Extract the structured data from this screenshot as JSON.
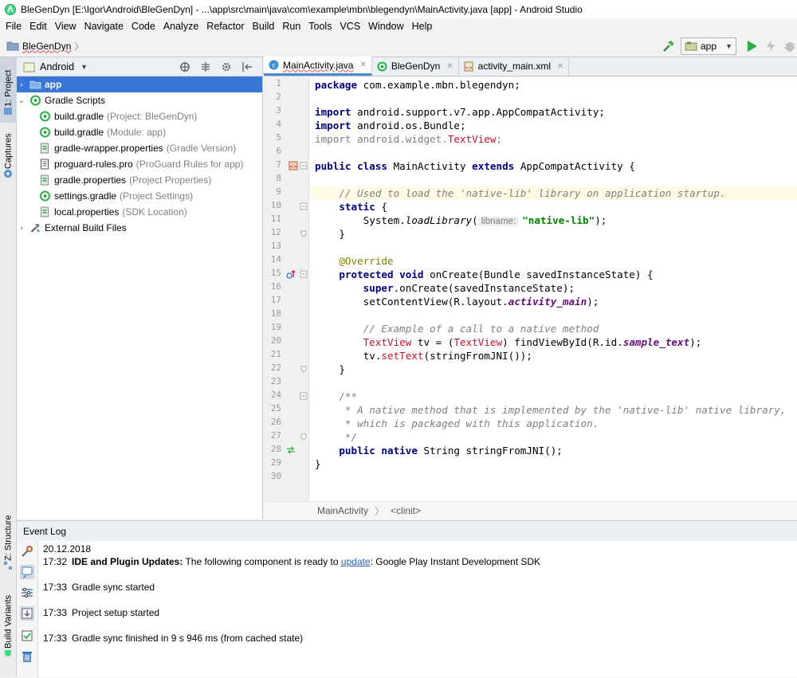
{
  "window": {
    "title": "BleGenDyn [E:\\Igor\\Android\\BleGenDyn] - ...\\app\\src\\main\\java\\com\\example\\mbn\\blegendyn\\MainActivity.java [app] - Android Studio"
  },
  "menu": [
    "File",
    "Edit",
    "View",
    "Navigate",
    "Code",
    "Analyze",
    "Refactor",
    "Build",
    "Run",
    "Tools",
    "VCS",
    "Window",
    "Help"
  ],
  "navbar": {
    "project_crumb": "BleGenDyn",
    "run_config": "app"
  },
  "left_tool_tabs": {
    "project": "1: Project",
    "captures": "Captures",
    "structure": "Z: Structure",
    "build_variants": "Build Variants"
  },
  "project_panel": {
    "view_mode": "Android",
    "tree": [
      {
        "label": "app",
        "hint": "",
        "expander": "›"
      },
      {
        "label": "Gradle Scripts",
        "hint": "",
        "expander": "⌄"
      },
      {
        "label": "build.gradle",
        "hint": "(Project: BleGenDyn)",
        "expander": ""
      },
      {
        "label": "build.gradle",
        "hint": "(Module: app)",
        "expander": ""
      },
      {
        "label": "gradle-wrapper.properties",
        "hint": "(Gradle Version)",
        "expander": ""
      },
      {
        "label": "proguard-rules.pro",
        "hint": "(ProGuard Rules for app)",
        "expander": ""
      },
      {
        "label": "gradle.properties",
        "hint": "(Project Properties)",
        "expander": ""
      },
      {
        "label": "settings.gradle",
        "hint": "(Project Settings)",
        "expander": ""
      },
      {
        "label": "local.properties",
        "hint": "(SDK Location)",
        "expander": ""
      },
      {
        "label": "External Build Files",
        "hint": "",
        "expander": "›"
      }
    ]
  },
  "editor_tabs": [
    {
      "label": "MainActivity.java"
    },
    {
      "label": "BleGenDyn"
    },
    {
      "label": "activity_main.xml"
    }
  ],
  "line_numbers": [
    "1",
    "2",
    "3",
    "4",
    "5",
    "6",
    "7",
    "8",
    "9",
    "10",
    "11",
    "12",
    "13",
    "14",
    "15",
    "16",
    "17",
    "18",
    "19",
    "20",
    "21",
    "22",
    "23",
    "24",
    "25",
    "26",
    "27",
    "28",
    "29",
    "30"
  ],
  "code": {
    "l1_kw": "package",
    "l1_rest": " com.example.mbn.blegendyn;",
    "l3_kw": "import",
    "l3_rest": " android.support.v7.app.AppCompatActivity;",
    "l4_kw": "import",
    "l4_rest": " android.os.Bundle;",
    "l5_a": "import android.widget.",
    "l5_b": "TextView",
    "l5_c": ";",
    "l7_kw1": "public class",
    "l7_a": " MainActivity ",
    "l7_kw2": "extends",
    "l7_b": " AppCompatActivity {",
    "l9_cmt": "    // Used to load the 'native-lib' library on application startup.",
    "l10_kw": "    static",
    "l10_rest": " {",
    "l11_a": "        System.",
    "l11_b": "loadLibrary",
    "l11_c": "(",
    "l11_hint": "libname:",
    "l11_str": "\"native-lib\"",
    "l11_d": ");",
    "l12": "    }",
    "l14_ann": "    @Override",
    "l15_kw": "    protected void",
    "l15_rest": " onCreate(Bundle savedInstanceState) {",
    "l16_kw": "        super",
    "l16_rest": ".onCreate(savedInstanceState);",
    "l17_a": "        setContentView(R.layout.",
    "l17_fld": "activity_main",
    "l17_b": ");",
    "l19_cmt": "        // Example of a call to a native method",
    "l20_a": "        ",
    "l20_red1": "TextView",
    "l20_b": " tv = (",
    "l20_red2": "TextView",
    "l20_c": ") findViewById(R.id.",
    "l20_fld": "sample_text",
    "l20_d": ");",
    "l21_a": "        tv.",
    "l21_red": "setText",
    "l21_b": "(stringFromJNI());",
    "l22": "    }",
    "l24_cmt": "    /**",
    "l25_cmt": "     * A native method that is implemented by the 'native-lib' native library,",
    "l26_cmt": "     * which is packaged with this application.",
    "l27_cmt": "     */",
    "l28_kw": "    public native",
    "l28_rest": " String stringFromJNI();",
    "l29": "}"
  },
  "editor_breadcrumb": {
    "class": "MainActivity",
    "method": "<clinit>"
  },
  "event_log": {
    "title": "Event Log",
    "date": "20.12.2018",
    "entries": [
      {
        "time": "17:32",
        "bold": "IDE and Plugin Updates:",
        "text_before": " The following component is ready to ",
        "link": "update",
        "text_after": ": Google Play Instant Development SDK"
      },
      {
        "time": "17:33",
        "text": "Gradle sync started"
      },
      {
        "time": "17:33",
        "text": "Project setup started"
      },
      {
        "time": "17:33",
        "text": "Gradle sync finished in 9 s 946 ms (from cached state)"
      }
    ]
  },
  "colors": {
    "keyword": "#000080",
    "comment": "#808080",
    "string": "#008000",
    "annotation": "#808000",
    "field": "#660e7a",
    "error": "#c8102e",
    "selection": "#3875d6",
    "highlight_line": "#fffae3"
  },
  "icons": {
    "title": "android-studio-icon",
    "build": "hammer-icon",
    "run": "run-icon",
    "gradle": "gradle-icon",
    "folder": "folder-icon",
    "java_class": "java-class-icon"
  }
}
